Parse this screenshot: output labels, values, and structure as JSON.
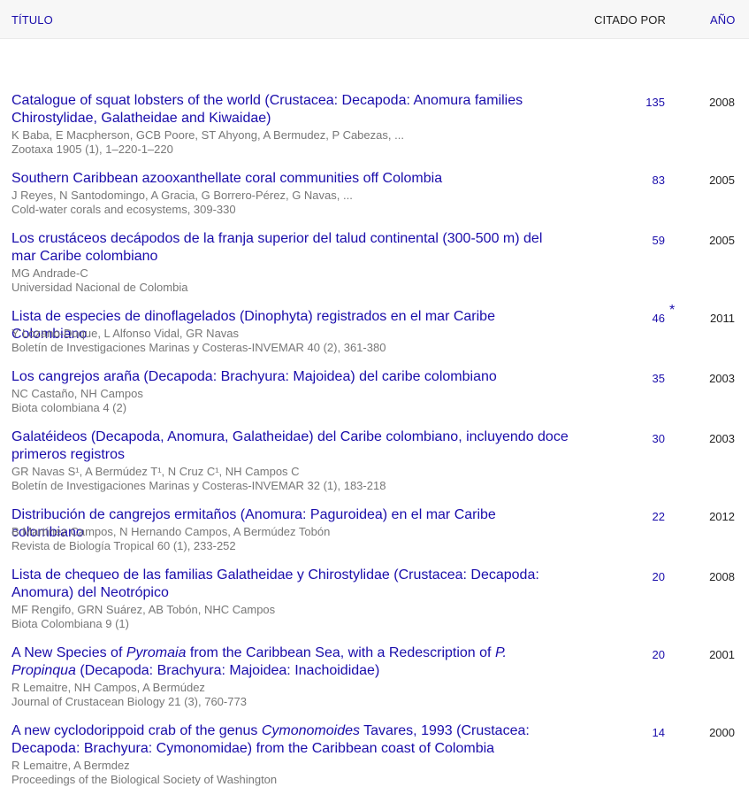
{
  "header": {
    "title_label": "TÍTULO",
    "cited_label": "CITADO POR",
    "year_label": "AÑO"
  },
  "rows": [
    {
      "title_parts": [
        {
          "text": "Catalogue of squat lobsters of the world (Crustacea: Decapoda: Anomura families Chirostylidae, Galatheidae and Kiwaidae)",
          "italic": false
        }
      ],
      "authors": "K Baba, E Macpherson, GCB Poore, ST Ahyong, A Bermudez, P Cabezas, ...",
      "venue": "Zootaxa 1905 (1), 1–220-1–220",
      "cited": "135",
      "star": "",
      "year": "2008"
    },
    {
      "title_parts": [
        {
          "text": "Southern Caribbean azooxanthellate coral communities off Colombia",
          "italic": false
        }
      ],
      "authors": "J Reyes, N Santodomingo, A Gracia, G Borrero-Pérez, G Navas, ...",
      "venue": "Cold-water corals and ecosystems, 309-330",
      "cited": "83",
      "star": "",
      "year": "2005"
    },
    {
      "title_parts": [
        {
          "text": "Los crustáceos decápodos de la franja superior del talud continental (300-500 m) del mar Caribe colombiano",
          "italic": false
        }
      ],
      "authors": "MG Andrade-C",
      "venue": "Universidad Nacional de Colombia",
      "cited": "59",
      "star": "",
      "year": "2005"
    },
    {
      "title_parts": [
        {
          "text": "Lista de especies de dinoflagelados (Dinophyta) registrados en el mar Caribe Colombiano",
          "italic": false
        }
      ],
      "authors": "Y Lozano-Duque, L Alfonso Vidal, GR Navas",
      "venue": "Boletín de Investigaciones Marinas y Costeras-INVEMAR 40 (2), 361-380",
      "cited": "46",
      "star": "*",
      "year": "2011"
    },
    {
      "title_parts": [
        {
          "text": "Los cangrejos araña (Decapoda: Brachyura: Majoidea) del caribe colombiano",
          "italic": false
        }
      ],
      "authors": "NC Castaño, NH Campos",
      "venue": "Biota colombiana 4 (2)",
      "cited": "35",
      "star": "",
      "year": "2003"
    },
    {
      "title_parts": [
        {
          "text": "Galatéideos (Decapoda, Anomura, Galatheidae) del Caribe colombiano, incluyendo doce primeros registros",
          "italic": false
        }
      ],
      "authors": "GR Navas S¹, A Bermúdez T¹, N Cruz C¹, NH Campos C",
      "venue": "Boletín de Investigaciones Marinas y Costeras-INVEMAR 32 (1), 183-218",
      "cited": "30",
      "star": "",
      "year": "2003"
    },
    {
      "title_parts": [
        {
          "text": "Distribución de cangrejos ermitaños (Anomura: Paguroidea) en el mar Caribe colombiano",
          "italic": false
        }
      ],
      "authors": "B Martínez Campos, N Hernando Campos, A Bermúdez Tobón",
      "venue": "Revista de Biología Tropical 60 (1), 233-252",
      "cited": "22",
      "star": "",
      "year": "2012"
    },
    {
      "title_parts": [
        {
          "text": "Lista de chequeo de las familias Galatheidae y Chirostylidae (Crustacea: Decapoda: Anomura) del Neotrópico",
          "italic": false
        }
      ],
      "authors": "MF Rengifo, GRN Suárez, AB Tobón, NHC Campos",
      "venue": "Biota Colombiana 9 (1)",
      "cited": "20",
      "star": "",
      "year": "2008"
    },
    {
      "title_parts": [
        {
          "text": "A New Species of ",
          "italic": false
        },
        {
          "text": "Pyromaia",
          "italic": true
        },
        {
          "text": " from the Caribbean Sea, with a Redescription of ",
          "italic": false
        },
        {
          "text": "P. Propinqua",
          "italic": true
        },
        {
          "text": " (Decapoda: Brachyura: Majoidea: Inachoididae)",
          "italic": false
        }
      ],
      "authors": "R Lemaitre, NH Campos, A Bermúdez",
      "venue": "Journal of Crustacean Biology 21 (3), 760-773",
      "cited": "20",
      "star": "",
      "year": "2001"
    },
    {
      "title_parts": [
        {
          "text": "A new cyclodorippoid crab of the genus ",
          "italic": false
        },
        {
          "text": "Cymonomoides",
          "italic": true
        },
        {
          "text": " Tavares, 1993 (Crustacea: Decapoda: Brachyura: Cymonomidae) from the Caribbean coast of Colombia",
          "italic": false
        }
      ],
      "authors": "R Lemaitre, A Bermdez",
      "venue": "Proceedings of the Biological Society of Washington",
      "cited": "14",
      "star": "",
      "year": "2000"
    }
  ]
}
